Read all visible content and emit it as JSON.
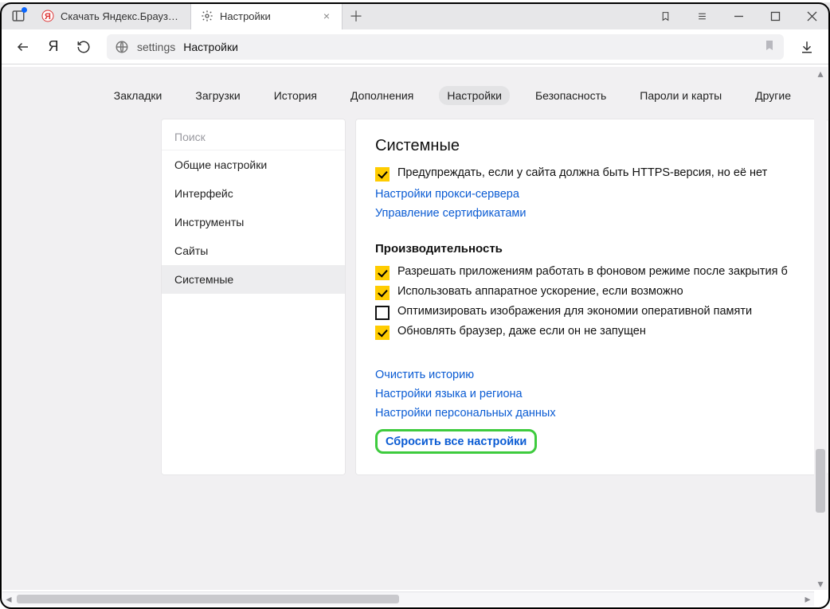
{
  "tabs": [
    {
      "title": "Скачать Яндекс.Браузер д",
      "favicon": "yandex-favicon"
    },
    {
      "title": "Настройки",
      "favicon": "gear-favicon"
    }
  ],
  "omnibox": {
    "host": "settings",
    "path": "Настройки"
  },
  "settings_nav": {
    "items": [
      "Закладки",
      "Загрузки",
      "История",
      "Дополнения",
      "Настройки",
      "Безопасность",
      "Пароли и карты",
      "Другие"
    ],
    "active_index": 4
  },
  "sidebar": {
    "search_placeholder": "Поиск",
    "items": [
      "Общие настройки",
      "Интерфейс",
      "Инструменты",
      "Сайты",
      "Системные"
    ],
    "active_index": 4
  },
  "main": {
    "title": "Системные",
    "https_row": "Предупреждать, если у сайта должна быть HTTPS-версия, но её нет",
    "proxy_link": "Настройки прокси-сервера",
    "cert_link": "Управление сертификатами",
    "perf_title": "Производительность",
    "perf_rows": [
      {
        "checked": true,
        "label": "Разрешать приложениям работать в фоновом режиме после закрытия б"
      },
      {
        "checked": true,
        "label": "Использовать аппаратное ускорение, если возможно"
      },
      {
        "checked": false,
        "label": "Оптимизировать изображения для экономии оперативной памяти"
      },
      {
        "checked": true,
        "label": "Обновлять браузер, даже если он не запущен"
      }
    ],
    "links": [
      "Очистить историю",
      "Настройки языка и региона",
      "Настройки персональных данных"
    ],
    "reset_link": "Сбросить все настройки"
  }
}
